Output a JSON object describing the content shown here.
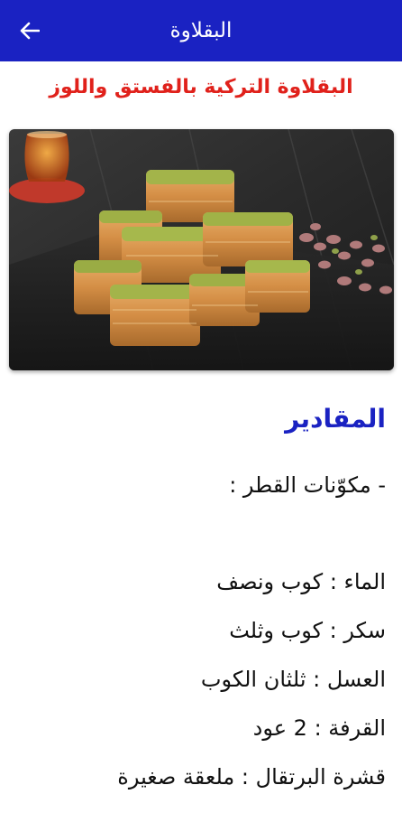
{
  "app_bar": {
    "title": "البقلاوة",
    "back_icon": "arrow-left-icon",
    "background": "#1a22c2"
  },
  "recipe": {
    "title": "البقلاوة التركية بالفستق واللوز",
    "title_color": "#e0211b",
    "image_alt": "baklava-photo"
  },
  "ingredients": {
    "heading": "المقادير",
    "heading_color": "#1a22c2",
    "lines": [
      "- مكوّنات القطر :",
      "الماء : كوب ونصف",
      "سكر : كوب وثلث",
      "العسل : ثلثان الكوب",
      "القرفة : 2 عود",
      "قشرة البرتقال : ملعقة صغيرة"
    ]
  }
}
